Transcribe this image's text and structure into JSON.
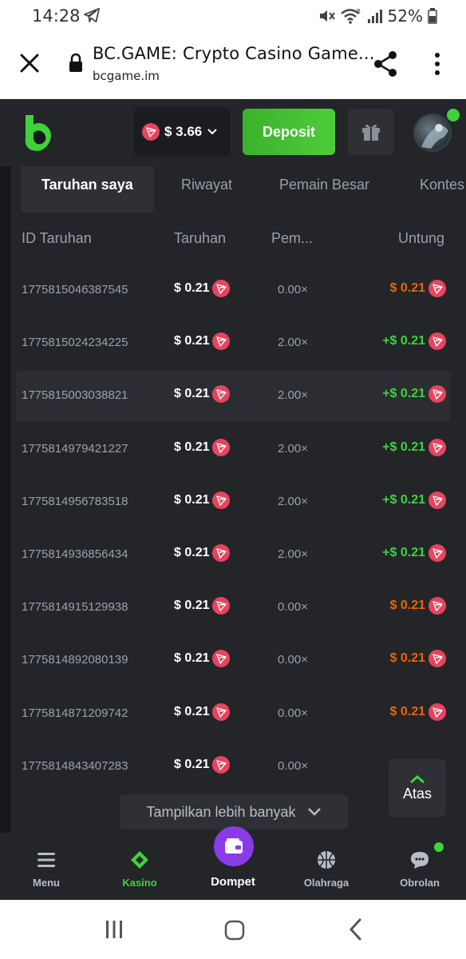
{
  "status_bar": {
    "time": "14:28",
    "battery": "52%"
  },
  "browser": {
    "page_title": "BC.GAME: Crypto Casino Game...",
    "domain": "bcgame.im"
  },
  "header": {
    "balance": "$ 3.66",
    "deposit_label": "Deposit"
  },
  "tabs": [
    {
      "label": "Taruhan saya",
      "active": true
    },
    {
      "label": "Riwayat",
      "active": false
    },
    {
      "label": "Pemain Besar",
      "active": false
    },
    {
      "label": "Kontes",
      "active": false
    }
  ],
  "table": {
    "columns": [
      "ID Taruhan",
      "Taruhan",
      "Pem...",
      "Untung"
    ],
    "rows": [
      {
        "id": "1775815046387545",
        "bet": "$ 0.21",
        "mult": "0.00×",
        "profit": "$ 0.21",
        "win": false,
        "highlight": false
      },
      {
        "id": "1775815024234225",
        "bet": "$ 0.21",
        "mult": "2.00×",
        "profit": "+$ 0.21",
        "win": true,
        "highlight": false
      },
      {
        "id": "1775815003038821",
        "bet": "$ 0.21",
        "mult": "2.00×",
        "profit": "+$ 0.21",
        "win": true,
        "highlight": true
      },
      {
        "id": "1775814979421227",
        "bet": "$ 0.21",
        "mult": "2.00×",
        "profit": "+$ 0.21",
        "win": true,
        "highlight": false
      },
      {
        "id": "1775814956783518",
        "bet": "$ 0.21",
        "mult": "2.00×",
        "profit": "+$ 0.21",
        "win": true,
        "highlight": false
      },
      {
        "id": "1775814936856434",
        "bet": "$ 0.21",
        "mult": "2.00×",
        "profit": "+$ 0.21",
        "win": true,
        "highlight": false
      },
      {
        "id": "1775814915129938",
        "bet": "$ 0.21",
        "mult": "0.00×",
        "profit": "$ 0.21",
        "win": false,
        "highlight": false
      },
      {
        "id": "1775814892080139",
        "bet": "$ 0.21",
        "mult": "0.00×",
        "profit": "$ 0.21",
        "win": false,
        "highlight": false
      },
      {
        "id": "1775814871209742",
        "bet": "$ 0.21",
        "mult": "0.00×",
        "profit": "$ 0.21",
        "win": false,
        "highlight": false
      },
      {
        "id": "1775814843407283",
        "bet": "$ 0.21",
        "mult": "0.00×",
        "profit": "",
        "win": false,
        "highlight": false
      }
    ]
  },
  "show_more_label": "Tampilkan lebih banyak",
  "to_top_label": "Atas",
  "bottom_nav": [
    {
      "label": "Menu",
      "icon": "menu-icon",
      "active": false
    },
    {
      "label": "Kasino",
      "icon": "casino-icon",
      "active": true
    },
    {
      "label": "Dompet",
      "icon": "wallet-icon",
      "active": false
    },
    {
      "label": "Olahraga",
      "icon": "sports-ball-icon",
      "active": false
    },
    {
      "label": "Obrolan",
      "icon": "chat-icon",
      "active": false
    }
  ],
  "colors": {
    "win": "#3fd33a",
    "loss": "#ed6300",
    "accent_green": "#3bb22e",
    "wallet_purple": "#8a3be8",
    "background": "#17181b",
    "panel": "#232529"
  }
}
